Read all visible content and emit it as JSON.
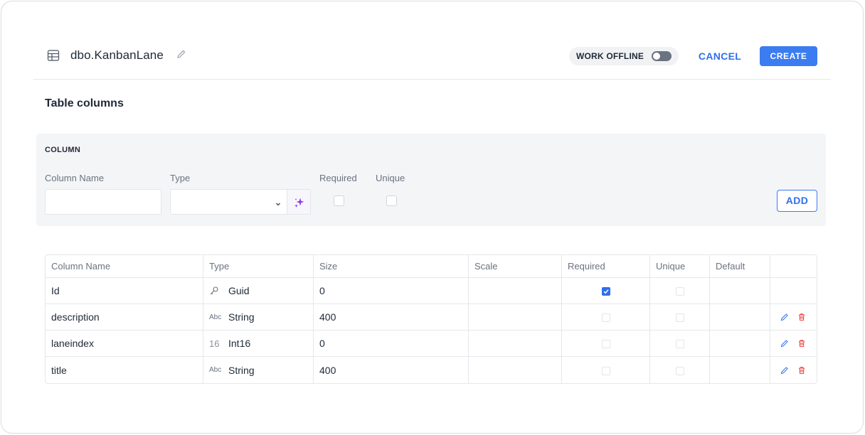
{
  "header": {
    "table_name": "dbo.KanbanLane",
    "work_offline_label": "WORK OFFLINE",
    "work_offline_enabled": false,
    "cancel_label": "CANCEL",
    "create_label": "CREATE"
  },
  "section_title": "Table columns",
  "column_form": {
    "title": "COLUMN",
    "column_name_label": "Column Name",
    "column_name_value": "",
    "type_label": "Type",
    "type_value": "",
    "required_label": "Required",
    "required_checked": false,
    "unique_label": "Unique",
    "unique_checked": false,
    "add_label": "ADD"
  },
  "table": {
    "headers": [
      "Column Name",
      "Type",
      "Size",
      "Scale",
      "Required",
      "Unique",
      "Default",
      ""
    ],
    "rows": [
      {
        "name": "Id",
        "type": "Guid",
        "type_icon": "key-icon",
        "size": "0",
        "scale": "",
        "required": true,
        "unique": false,
        "default": "",
        "editable": false
      },
      {
        "name": "description",
        "type": "String",
        "type_icon": "Abc",
        "size": "400",
        "scale": "",
        "required": false,
        "unique": false,
        "default": "",
        "editable": true
      },
      {
        "name": "laneindex",
        "type": "Int16",
        "type_icon": "16",
        "size": "0",
        "scale": "",
        "required": false,
        "unique": false,
        "default": "",
        "editable": true
      },
      {
        "name": "title",
        "type": "String",
        "type_icon": "Abc",
        "size": "400",
        "scale": "",
        "required": false,
        "unique": false,
        "default": "",
        "editable": true
      }
    ]
  },
  "colors": {
    "accent": "#3b7cf0",
    "delete": "#ef4444",
    "ai_sparkle": "#9333ea"
  }
}
